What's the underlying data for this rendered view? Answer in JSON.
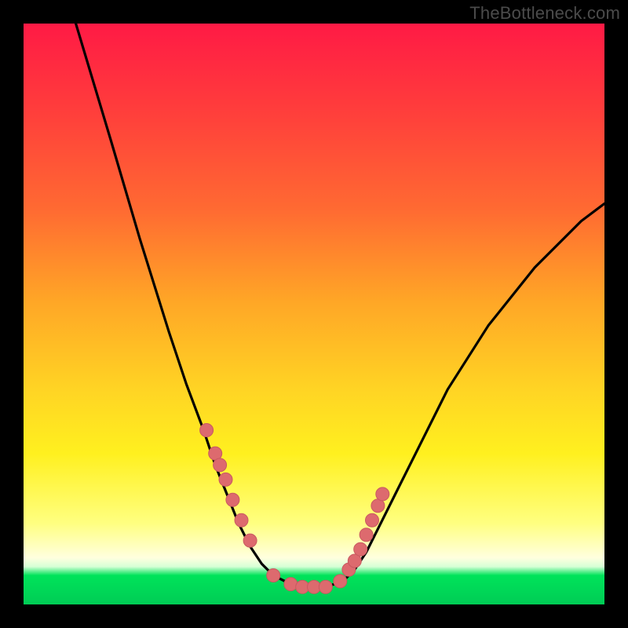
{
  "watermark": "TheBottleneck.com",
  "colors": {
    "bg": "#000000",
    "curve": "#000000",
    "marker_fill": "#dd6a6e",
    "marker_stroke": "#c95a60",
    "gradient_top": "#ff1a45",
    "gradient_mid": "#ffd424",
    "gradient_bottom": "#00cc55"
  },
  "chart_data": {
    "type": "line",
    "title": "",
    "xlabel": "",
    "ylabel": "",
    "xlim": [
      0,
      100
    ],
    "ylim": [
      0,
      100
    ],
    "note": "Axes are unlabeled; values are estimated plot-area percentages (0 = left/bottom, 100 = right/top). The curve is a V-shaped bottleneck profile with its minimum near the bottom-center. Markers cluster on both descending and ascending flanks near the bottom.",
    "series": [
      {
        "name": "bottleneck-curve",
        "x": [
          9,
          15,
          20,
          25,
          28,
          31,
          33,
          35,
          37,
          39,
          41,
          43,
          45,
          48,
          52,
          55,
          57,
          59,
          61,
          64,
          68,
          73,
          80,
          88,
          96,
          100
        ],
        "y": [
          100,
          80,
          63,
          47,
          38,
          30,
          24,
          19,
          14,
          10,
          7,
          5,
          4,
          3,
          3,
          4,
          6,
          9,
          13,
          19,
          27,
          37,
          48,
          58,
          66,
          69
        ]
      }
    ],
    "markers": {
      "name": "sample-points",
      "x": [
        31.5,
        33.0,
        33.8,
        34.8,
        36.0,
        37.5,
        39.0,
        43.0,
        46.0,
        48.0,
        50.0,
        52.0,
        54.5,
        56.0,
        57.0,
        58.0,
        59.0,
        60.0,
        61.0,
        61.8
      ],
      "y": [
        30.0,
        26.0,
        24.0,
        21.5,
        18.0,
        14.5,
        11.0,
        5.0,
        3.5,
        3.0,
        3.0,
        3.0,
        4.0,
        6.0,
        7.5,
        9.5,
        12.0,
        14.5,
        17.0,
        19.0
      ]
    }
  }
}
